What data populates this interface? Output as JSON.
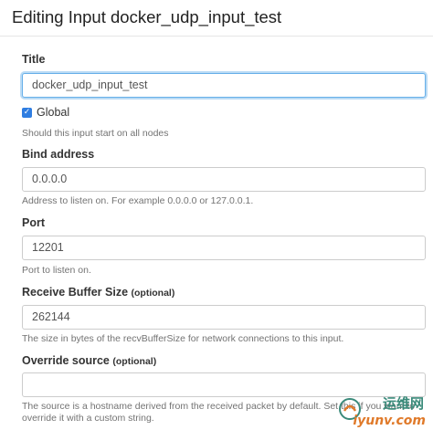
{
  "modal": {
    "title": "Editing Input docker_udp_input_test"
  },
  "fields": {
    "title": {
      "label": "Title",
      "value": "docker_udp_input_test"
    },
    "global": {
      "label": "Global",
      "checked": true,
      "help": "Should this input start on all nodes"
    },
    "bind_address": {
      "label": "Bind address",
      "value": "0.0.0.0",
      "help": "Address to listen on. For example 0.0.0.0 or 127.0.0.1."
    },
    "port": {
      "label": "Port",
      "value": "12201",
      "help": "Port to listen on."
    },
    "recv_buffer": {
      "label": "Receive Buffer Size",
      "optional": "(optional)",
      "value": "262144",
      "help": "The size in bytes of the recvBufferSize for network connections to this input."
    },
    "override_source": {
      "label": "Override source",
      "optional": "(optional)",
      "value": "",
      "help_line1": "The source is a hostname derived from the received packet by default. Set this if you want to",
      "help_line2": "override it with a custom string."
    }
  },
  "watermark": {
    "top": "运维网",
    "bottom": "iyunv.com"
  },
  "colors": {
    "focus": "#66afe9",
    "checkbox": "#2f7de1"
  }
}
